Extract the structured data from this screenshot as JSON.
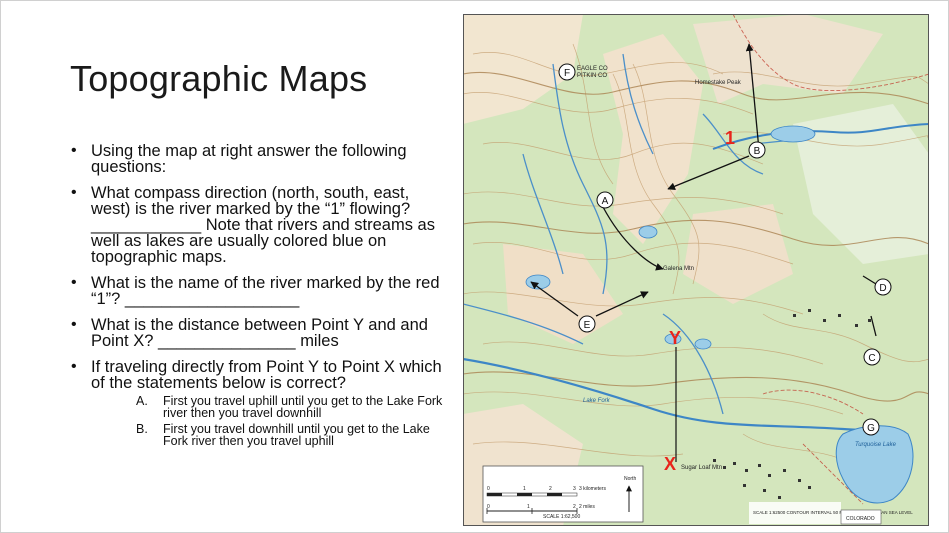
{
  "slide": {
    "title": "Topographic Maps",
    "bullets": [
      "Using the map at right answer the following questions:",
      "What compass direction (north, south, east, west) is the river marked by the “1” flowing? ____________ Note that rivers and streams as well as lakes are usually colored blue on topographic maps.",
      "What is the name of the river marked by the red “1”? ___________________",
      "What is the distance between Point Y and and Point X? _______________ miles",
      "If traveling directly from Point Y to Point X which of the statements below is correct?"
    ],
    "options": [
      {
        "marker": "A.",
        "text": "First you travel uphill until you get to the Lake Fork river then you travel downhill"
      },
      {
        "marker": "B.",
        "text": "First you travel downhill until you get to the Lake Fork river then you travel uphill"
      }
    ]
  },
  "map": {
    "marker_1": "1",
    "marker_y": "Y",
    "marker_x": "X",
    "circle_labels": [
      "A",
      "B",
      "C",
      "D",
      "E",
      "F",
      "G"
    ],
    "place_labels": [
      "EAGLE CO",
      "PITKIN CO",
      "Homestake Peak",
      "Lake Fork",
      "Turquoise Lake",
      "Sugar Loaf Mtn",
      "Galena Mtn"
    ],
    "scale": {
      "km_label": "3 kilometers",
      "mi_label": "2 miles",
      "scale_text": "SCALE 1:62,500",
      "north_label": "North",
      "km_ticks": [
        "0",
        "1",
        "2",
        "3"
      ],
      "mi_ticks": [
        "0",
        "1",
        "2"
      ]
    },
    "footer": {
      "contour_text": "SCALE 1:62500 CONTOUR INTERVAL 50 FEET DATUM IS MEAN SEA LEVEL",
      "state_label": "COLORADO"
    },
    "colors": {
      "marker_red": "#e8251c",
      "water": "#9ccde8",
      "forest": "#cfe3b6"
    }
  }
}
